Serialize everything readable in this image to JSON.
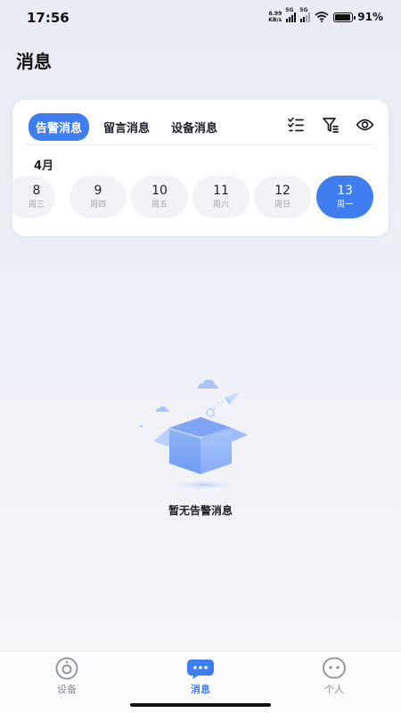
{
  "status_bar": {
    "time": "17:56",
    "net_speed_value": "6.99",
    "net_speed_unit": "KB/s",
    "signal_1_tag": "5G",
    "signal_2_tag": "5G",
    "battery_level": 0.91,
    "battery_percent": "91%"
  },
  "page": {
    "title": "消息"
  },
  "tabs": [
    {
      "label": "告警消息",
      "active": true
    },
    {
      "label": "留言消息",
      "active": false
    },
    {
      "label": "设备消息",
      "active": false
    }
  ],
  "toolbar": {
    "icons": [
      "list-check-icon",
      "filter-icon",
      "eye-icon"
    ]
  },
  "calendar": {
    "month": "4月",
    "dates": [
      {
        "day": "8",
        "weekday": "周三"
      },
      {
        "day": "9",
        "weekday": "周四"
      },
      {
        "day": "10",
        "weekday": "周五"
      },
      {
        "day": "11",
        "weekday": "周六"
      },
      {
        "day": "12",
        "weekday": "周日"
      },
      {
        "day": "13",
        "weekday": "周一",
        "selected": true
      }
    ]
  },
  "empty_state": {
    "text": "暂无告警消息",
    "icon": "empty-box-illustration"
  },
  "bottom_nav": [
    {
      "label": "设备",
      "icon": "camera-icon",
      "active": false
    },
    {
      "label": "消息",
      "icon": "message-icon",
      "active": true
    },
    {
      "label": "个人",
      "icon": "profile-face-icon",
      "active": false
    }
  ],
  "colors": {
    "accent": "#3f7ef0",
    "background": "#eef0f7",
    "text": "#1c1f26",
    "muted": "#9aa0aa"
  }
}
